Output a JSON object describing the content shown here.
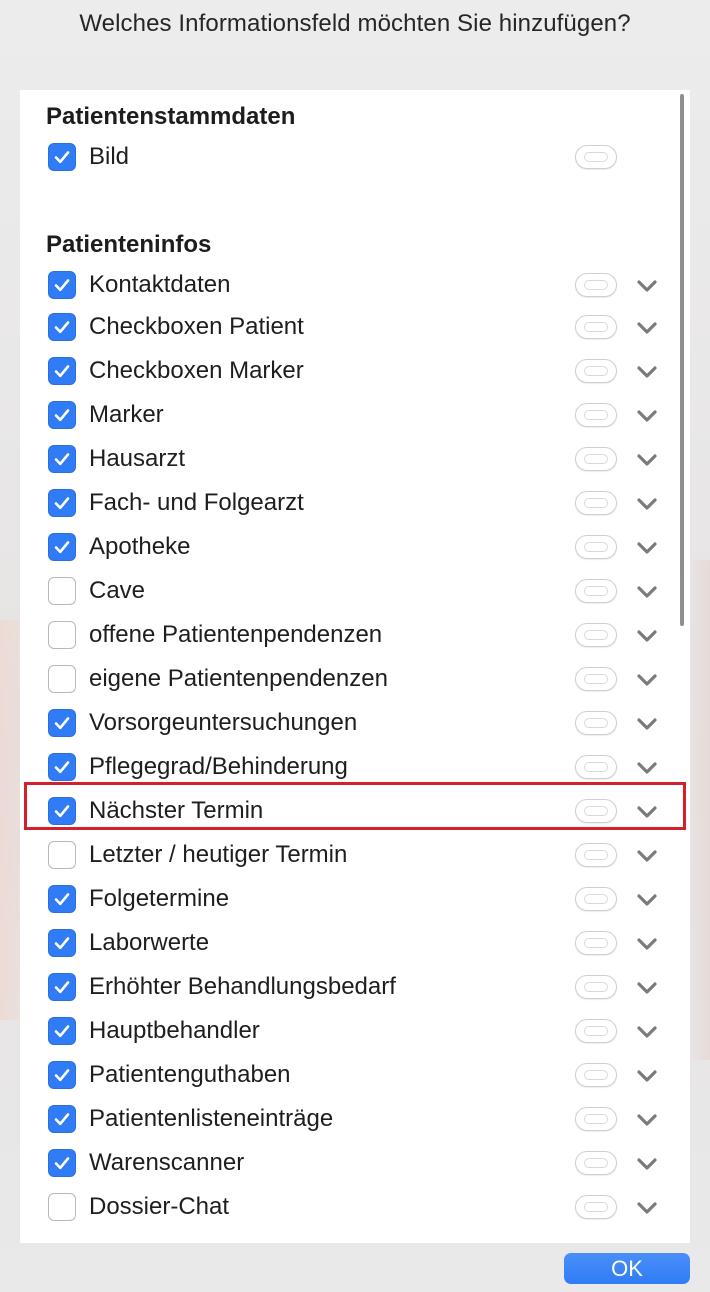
{
  "dialog": {
    "question": "Welches Informationsfeld möchten Sie hinzufügen?",
    "ok_label": "OK"
  },
  "colors": {
    "accent": "#2f7cf6",
    "highlight": "#d2202f"
  },
  "sections": [
    {
      "title": "Patientenstammdaten",
      "items": [
        {
          "label": "Bild",
          "checked": true,
          "has_chevron": false
        }
      ]
    },
    {
      "title": "Patienteninfos",
      "items": [
        {
          "label": "Kontaktdaten",
          "checked": true,
          "has_chevron": true
        },
        {
          "label": "Checkboxen Patient",
          "checked": true,
          "has_chevron": true
        },
        {
          "label": "Checkboxen Marker",
          "checked": true,
          "has_chevron": true
        },
        {
          "label": "Marker",
          "checked": true,
          "has_chevron": true
        },
        {
          "label": "Hausarzt",
          "checked": true,
          "has_chevron": true
        },
        {
          "label": "Fach- und Folgearzt",
          "checked": true,
          "has_chevron": true
        },
        {
          "label": "Apotheke",
          "checked": true,
          "has_chevron": true
        },
        {
          "label": "Cave",
          "checked": false,
          "has_chevron": true
        },
        {
          "label": "offene Patientenpendenzen",
          "checked": false,
          "has_chevron": true
        },
        {
          "label": "eigene Patientenpendenzen",
          "checked": false,
          "has_chevron": true
        },
        {
          "label": "Vorsorgeuntersuchungen",
          "checked": true,
          "has_chevron": true
        },
        {
          "label": "Pflegegrad/Behinderung",
          "checked": true,
          "has_chevron": true
        },
        {
          "label": "Nächster Termin",
          "checked": true,
          "has_chevron": true,
          "highlighted": true
        },
        {
          "label": "Letzter / heutiger Termin",
          "checked": false,
          "has_chevron": true
        },
        {
          "label": "Folgetermine",
          "checked": true,
          "has_chevron": true
        },
        {
          "label": "Laborwerte",
          "checked": true,
          "has_chevron": true
        },
        {
          "label": "Erhöhter Behandlungsbedarf",
          "checked": true,
          "has_chevron": true
        },
        {
          "label": "Hauptbehandler",
          "checked": true,
          "has_chevron": true
        },
        {
          "label": "Patientenguthaben",
          "checked": true,
          "has_chevron": true
        },
        {
          "label": "Patientenlisteneinträge",
          "checked": true,
          "has_chevron": true
        },
        {
          "label": "Warenscanner",
          "checked": true,
          "has_chevron": true
        },
        {
          "label": "Dossier-Chat",
          "checked": false,
          "has_chevron": true
        }
      ]
    }
  ]
}
